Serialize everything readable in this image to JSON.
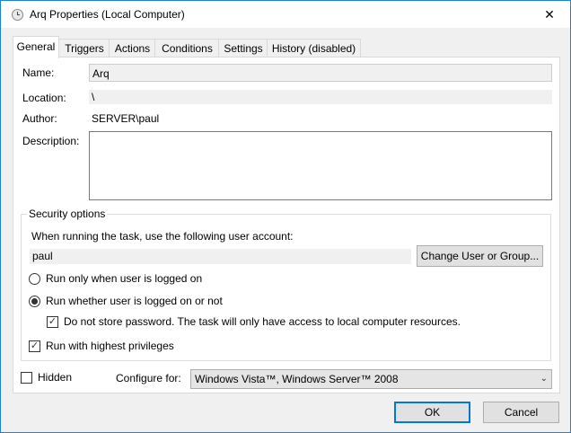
{
  "window": {
    "title": "Arq Properties (Local Computer)",
    "close_glyph": "✕"
  },
  "tabs": [
    {
      "label": "General"
    },
    {
      "label": "Triggers"
    },
    {
      "label": "Actions"
    },
    {
      "label": "Conditions"
    },
    {
      "label": "Settings"
    },
    {
      "label": "History (disabled)"
    }
  ],
  "general": {
    "name_label": "Name:",
    "name_value": "Arq",
    "location_label": "Location:",
    "location_value": "\\",
    "author_label": "Author:",
    "author_value": "SERVER\\paul",
    "description_label": "Description:",
    "description_value": ""
  },
  "security": {
    "group_title": "Security options",
    "account_prompt": "When running the task, use the following user account:",
    "account_value": "paul",
    "change_button": "Change User or Group...",
    "radio_logged_on": "Run only when user is logged on",
    "radio_logged_on_selected": false,
    "radio_whether": "Run whether user is logged on or not",
    "radio_whether_selected": true,
    "no_store_password": "Do not store password.  The task will only have access to local computer resources.",
    "no_store_password_checked": true,
    "highest_privileges": "Run with highest privileges",
    "highest_privileges_checked": true
  },
  "bottom": {
    "hidden_label": "Hidden",
    "hidden_checked": false,
    "configure_label": "Configure for:",
    "configure_value": "Windows Vista™, Windows Server™ 2008"
  },
  "buttons": {
    "ok": "OK",
    "cancel": "Cancel"
  },
  "colors": {
    "accent": "#0078d7",
    "window_border": "#1883d7"
  }
}
